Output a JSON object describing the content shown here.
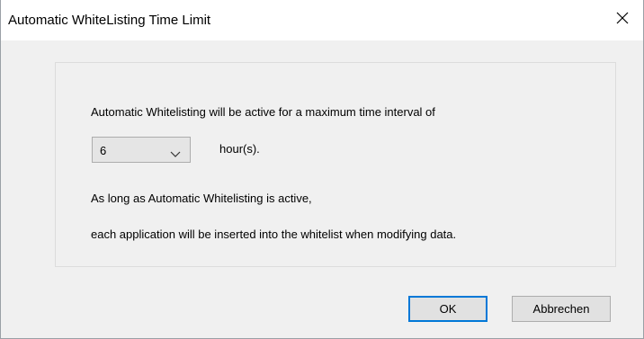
{
  "window": {
    "title": "Automatic WhiteListing Time Limit",
    "close_icon": "close-icon"
  },
  "content": {
    "line1": "Automatic Whitelisting will be active for a maximum time interval of",
    "duration": {
      "selected_value": "6",
      "unit_label": "hour(s)."
    },
    "line2": "As long as Automatic Whitelisting is active,",
    "line3": "each application will be inserted into the whitelist when modifying data."
  },
  "buttons": {
    "ok_label": "OK",
    "cancel_label": "Abbrechen"
  },
  "colors": {
    "dialog_background": "#f0f0f0",
    "titlebar_background": "#ffffff",
    "default_button_border": "#0078d7"
  }
}
